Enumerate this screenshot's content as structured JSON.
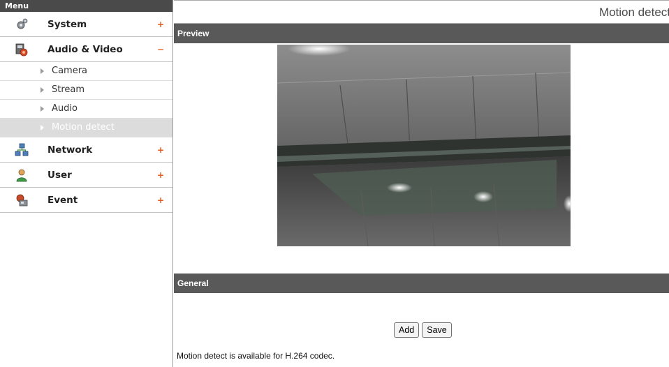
{
  "menu": {
    "header": "Menu",
    "categories": [
      {
        "label": "System",
        "toggle": "+",
        "icon": "gear-icon"
      },
      {
        "label": "Audio & Video",
        "toggle": "−",
        "icon": "film-camera-icon"
      },
      {
        "label": "Network",
        "toggle": "+",
        "icon": "network-icon"
      },
      {
        "label": "User",
        "toggle": "+",
        "icon": "user-icon"
      },
      {
        "label": "Event",
        "toggle": "+",
        "icon": "event-icon"
      }
    ],
    "audio_video_items": [
      {
        "label": "Camera"
      },
      {
        "label": "Stream"
      },
      {
        "label": "Audio"
      },
      {
        "label": "Motion detect",
        "selected": true
      }
    ]
  },
  "main": {
    "page_title": "Motion detect",
    "preview_header": "Preview",
    "general_header": "General",
    "buttons": {
      "add": "Add",
      "save": "Save"
    },
    "note": "Motion detect is available for H.264 codec."
  },
  "colors": {
    "accent_toggle": "#e05a1a",
    "section_header_bg": "#595959",
    "menu_header_bg": "#4a4a4a",
    "selected_item_bg": "#dcdcdc"
  }
}
